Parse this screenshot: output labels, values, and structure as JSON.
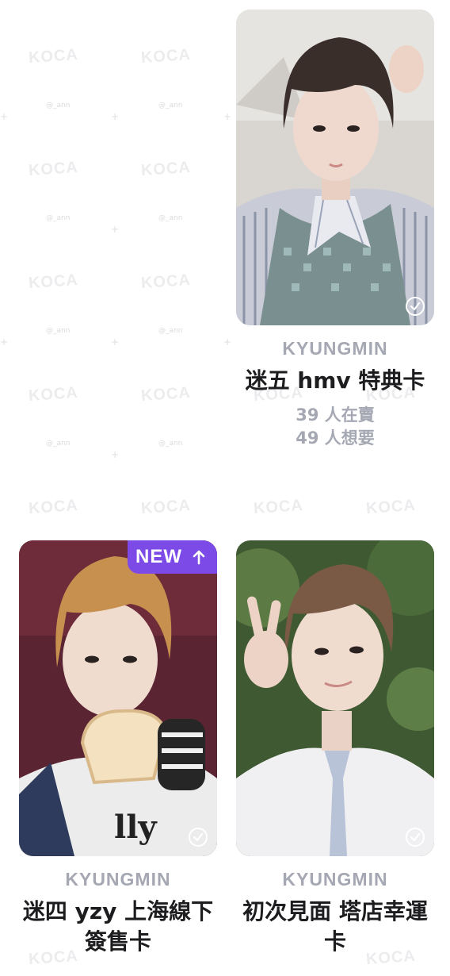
{
  "watermark": {
    "logo": "KOCA",
    "handle": "@_ann"
  },
  "cards": [
    {
      "member": "KYUNGMIN",
      "title": "迷五 hmv 特典卡",
      "selling": "39 人在賣",
      "wanting": "49 人想要",
      "owned_check_icon": "check-circle-icon"
    },
    {
      "member": "KYUNGMIN",
      "title": "迷四 yzy 上海線下 簽售卡",
      "badge": "NEW",
      "badge_icon": "arrow-up-icon",
      "owned_check_icon": "check-circle-icon"
    },
    {
      "member": "KYUNGMIN",
      "title": "初次見面 塔店幸運卡",
      "owned_check_icon": "check-circle-icon"
    }
  ],
  "colors": {
    "badge": "#7c4ae6",
    "muted": "#a5a8b3",
    "title": "#1d1d1f"
  }
}
